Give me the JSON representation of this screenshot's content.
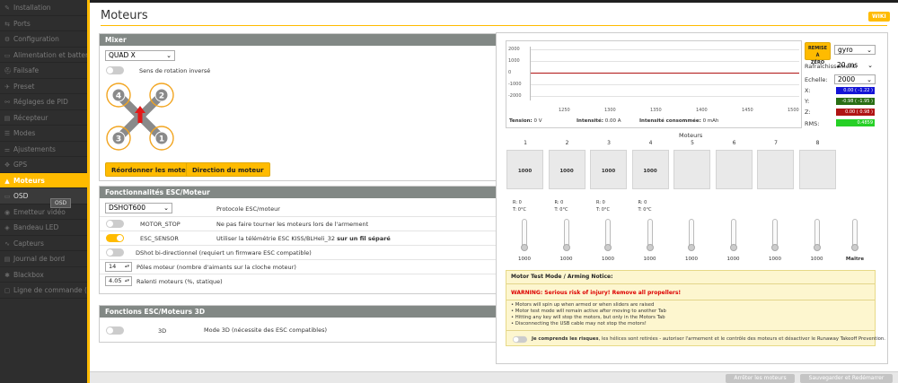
{
  "sidebar": {
    "items": [
      {
        "label": "Installation",
        "icon": "wrench-icon",
        "glyph": "✎"
      },
      {
        "label": "Ports",
        "icon": "plug-icon",
        "glyph": "⇆"
      },
      {
        "label": "Configuration",
        "icon": "gear-icon",
        "glyph": "⚙"
      },
      {
        "label": "Alimentation et batterie",
        "icon": "battery-icon",
        "glyph": "▭"
      },
      {
        "label": "Failsafe",
        "icon": "failsafe-icon",
        "glyph": "⛑"
      },
      {
        "label": "Preset",
        "icon": "preset-icon",
        "glyph": "✈"
      },
      {
        "label": "Réglages de PID",
        "icon": "pid-icon",
        "glyph": "⚯"
      },
      {
        "label": "Récepteur",
        "icon": "receiver-icon",
        "glyph": "▤"
      },
      {
        "label": "Modes",
        "icon": "modes-icon",
        "glyph": "☰"
      },
      {
        "label": "Ajustements",
        "icon": "sliders-icon",
        "glyph": "⚌"
      },
      {
        "label": "GPS",
        "icon": "satellite-icon",
        "glyph": "✥"
      },
      {
        "label": "Moteurs",
        "icon": "motor-icon",
        "glyph": "▲"
      },
      {
        "label": "OSD",
        "icon": "osd-icon",
        "glyph": "▭"
      },
      {
        "label": "Emetteur vidéo",
        "icon": "video-icon",
        "glyph": "◉"
      },
      {
        "label": "Bandeau LED",
        "icon": "led-icon",
        "glyph": "◈"
      },
      {
        "label": "Capteurs",
        "icon": "sensor-icon",
        "glyph": "∿"
      },
      {
        "label": "Journal de bord",
        "icon": "log-icon",
        "glyph": "▤"
      },
      {
        "label": "Blackbox",
        "icon": "blackbox-icon",
        "glyph": "✱"
      },
      {
        "label": "Ligne de commande (CLI)",
        "icon": "terminal-icon",
        "glyph": "▢"
      }
    ],
    "tooltip": "OSD"
  },
  "page": {
    "title": "Moteurs",
    "wiki": "WIKI"
  },
  "mixer": {
    "header": "Mixer",
    "select": "QUAD X",
    "reverse_label": "Sens de rotation inversé",
    "motor_numbers": [
      "4",
      "2",
      "3",
      "1"
    ],
    "reorder_button": "Réordonner les moteurs",
    "direction_button": "Direction du moteur"
  },
  "esc": {
    "header": "Fonctionnalités ESC/Moteur",
    "protocol": "DSHOT600",
    "protocol_label": "Protocole ESC/moteur",
    "motor_stop": "MOTOR_STOP",
    "motor_stop_desc": "Ne pas faire tourner les moteurs lors de l'armement",
    "esc_sensor": "ESC_SENSOR",
    "esc_sensor_desc": "Utiliser la télémétrie ESC KISS/BLHeli_32 ",
    "esc_sensor_desc_bold": "sur un fil séparé",
    "bidir": "DShot bi-directionnel (requiert un firmware ESC compatible)",
    "poles_value": "14",
    "poles_label": "Pôles moteur (nombre d'aimants sur la cloche moteur)",
    "idle_value": "4.05",
    "idle_label": "Ralenti moteurs (%, statique)"
  },
  "esc3d": {
    "header": "Fonctions ESC/Moteurs 3D",
    "label": "3D",
    "desc": "Mode 3D (nécessite des ESC compatibles)"
  },
  "graph": {
    "y_labels": [
      "2000",
      "1000",
      "0",
      "-1000",
      "-2000"
    ],
    "x_labels": [
      "1250",
      "1300",
      "1350",
      "1400",
      "1450",
      "1500"
    ],
    "tension_label": "Tension:",
    "tension_value": "0 V",
    "intensite_label": "Intensité:",
    "intensite_value": "0.00 A",
    "conso_label": "Intensité consommée:",
    "conso_value": "0 mAh",
    "reset_line1": "REMISE À",
    "reset_line2": "ZÉRO",
    "sensor_select": "gyro",
    "refresh_label": "Rafraîchissement:",
    "refresh_value": "20 ms",
    "scale_label": "Echelle:",
    "scale_value": "2000",
    "x_label": "X:",
    "x_value": "0.00 ( -1.22 )",
    "y_label": "Y:",
    "y_value": "-0.98 ( -1.95 )",
    "z_label": "Z:",
    "z_value": "0.00 ( 0.98 )",
    "rms_label": "RMS:",
    "rms_value": "0.4859",
    "x_color": "#1414d6",
    "y_color": "#2a6e14",
    "z_color": "#b01414",
    "rms_color": "#26d026"
  },
  "motors": {
    "title": "Moteurs",
    "numbers": [
      "1",
      "2",
      "3",
      "4",
      "5",
      "6",
      "7",
      "8"
    ],
    "values": [
      "1000",
      "1000",
      "1000",
      "1000",
      "",
      "",
      "",
      ""
    ],
    "r_label": "R:",
    "r_value": "0",
    "t_label": "T:",
    "t_value": "0°C",
    "slider_values": [
      "1000",
      "1000",
      "1000",
      "1000",
      "1000",
      "1000",
      "1000",
      "1000"
    ],
    "master_label": "Maître"
  },
  "notice": {
    "title": "Motor Test Mode / Arming Notice:",
    "warning": "WARNING: Serious risk of injury! Remove all propellers!",
    "items": [
      "• Motors will spin up when armed or when sliders are raised",
      "• Motor test mode will remain active after moving to another Tab",
      "• Hitting any key will stop the motors, but only in the Motors Tab",
      "• Disconnecting the USB cable may not stop the motors!"
    ],
    "agree_bold": "Je comprends les risques",
    "agree_rest": ", les hélices sont retirées - autoriser l'armement et le contrôle des moteurs et désactiver le Runaway Takeoff Prevention."
  },
  "footer": {
    "stop_button": "Arrêter les moteurs",
    "save_button": "Sauvegarder et Redémarrer"
  }
}
